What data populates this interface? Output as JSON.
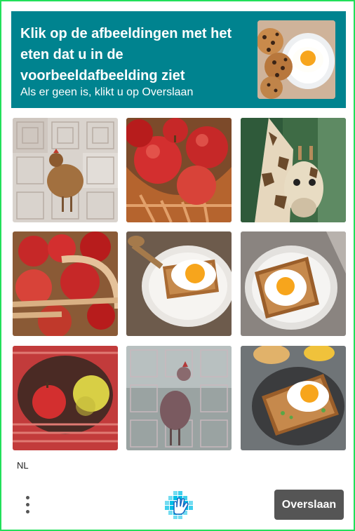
{
  "header": {
    "title": "Klik op de afbeeldingen met het eten dat u in de voorbeeldafbeelding ziet",
    "subtitle": "Als er geen is, klikt u op Overslaan"
  },
  "example_image": {
    "subject": "fried-egg-and-chocolate-chip-cookies"
  },
  "grid": {
    "tiles": [
      {
        "subject": "chicken-distorted"
      },
      {
        "subject": "apples-in-basket"
      },
      {
        "subject": "giraffe"
      },
      {
        "subject": "apples-in-basket"
      },
      {
        "subject": "fried-egg-on-toast"
      },
      {
        "subject": "fried-egg-on-toast"
      },
      {
        "subject": "apples-in-red-basket"
      },
      {
        "subject": "chicken-distorted"
      },
      {
        "subject": "fried-egg-on-toast"
      }
    ]
  },
  "footer": {
    "language": "NL",
    "skip_label": "Overslaan"
  },
  "colors": {
    "header_bg": "#00838f",
    "border": "#22e05a",
    "skip_bg": "#555555"
  }
}
